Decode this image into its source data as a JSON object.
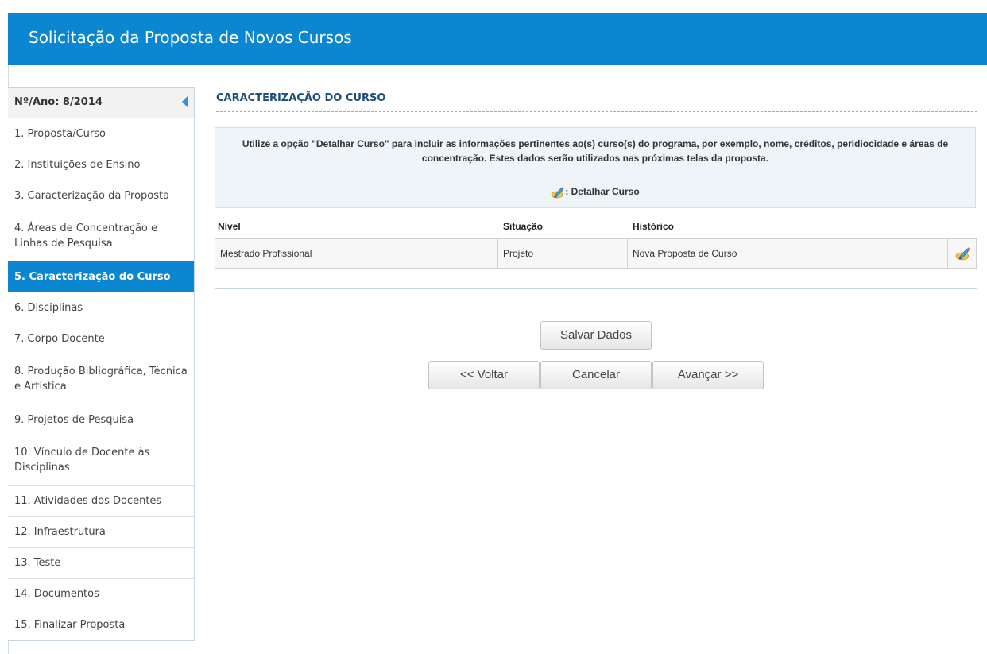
{
  "header": {
    "title": "Solicitação da Proposta de Novos Cursos"
  },
  "sidebar": {
    "head_label": "Nº/Ano: 8/2014",
    "items": [
      {
        "label": "1. Proposta/Curso"
      },
      {
        "label": "2. Instituições de Ensino"
      },
      {
        "label": "3. Caracterização da Proposta"
      },
      {
        "label": "4. Áreas de Concentração e Linhas de Pesquisa"
      },
      {
        "label": "5. Caracterização do Curso",
        "active": true
      },
      {
        "label": "6. Disciplinas"
      },
      {
        "label": "7. Corpo Docente"
      },
      {
        "label": "8. Produção Bibliográfica, Técnica e Artística"
      },
      {
        "label": "9. Projetos de Pesquisa"
      },
      {
        "label": "10. Vínculo de Docente às Disciplinas"
      },
      {
        "label": "11. Atividades dos Docentes"
      },
      {
        "label": "12. Infraestrutura"
      },
      {
        "label": "13. Teste"
      },
      {
        "label": "14. Documentos"
      },
      {
        "label": "15. Finalizar Proposta"
      }
    ]
  },
  "main": {
    "section_title": "CARACTERIZAÇÃO DO CURSO",
    "info_text": "Utilize a opção \"Detalhar Curso\" para incluir as informações pertinentes ao(s) curso(s) do programa, por exemplo, nome, créditos, peridiocidade e áreas de concentração. Estes dados serão utilizados nas próximas telas da proposta.",
    "legend_label": ": Detalhar Curso",
    "table": {
      "headers": [
        "Nível",
        "Situação",
        "Histórico"
      ],
      "rows": [
        {
          "nivel": "Mestrado Profissional",
          "situacao": "Projeto",
          "historico": "Nova Proposta de Curso"
        }
      ]
    },
    "buttons": {
      "save": "Salvar Dados",
      "back": "<< Voltar",
      "cancel": "Cancelar",
      "next": "Avançar >>"
    }
  },
  "icons": {
    "detail": "pencil-edit-icon",
    "collapse": "collapse-left-arrow-icon"
  },
  "colors": {
    "header_bg": "#0a87d0",
    "active_item_bg": "#0a87d0",
    "section_title": "#1d4e7b",
    "info_bg": "#eef4f8"
  }
}
